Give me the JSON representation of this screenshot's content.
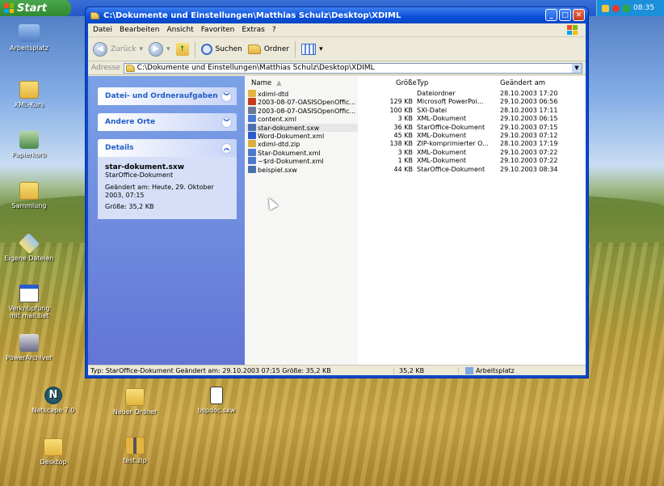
{
  "taskbar": {
    "start_label": "Start",
    "clock": "08:35"
  },
  "desktop_icons": [
    {
      "label": "Arbeitsplatz"
    },
    {
      "label": "XML-Kurs"
    },
    {
      "label": "Papierkorb"
    },
    {
      "label": "Sammlung"
    },
    {
      "label": "Eigene Dateien"
    },
    {
      "label": "Verknüpfung mit mail.bat"
    },
    {
      "label": "PowerArchiver"
    },
    {
      "label": "Netscape 7.0"
    },
    {
      "label": "Neuer Ordner"
    },
    {
      "label": "bspdoc.sxw"
    },
    {
      "label": "Desktop"
    },
    {
      "label": "test.zip"
    }
  ],
  "window": {
    "title": "C:\\Dokumente und Einstellungen\\Matthias Schulz\\Desktop\\XDIML",
    "menu": [
      "Datei",
      "Bearbeiten",
      "Ansicht",
      "Favoriten",
      "Extras",
      "?"
    ],
    "toolbar": {
      "back": "Zurück",
      "search": "Suchen",
      "folders": "Ordner"
    },
    "address": {
      "label": "Adresse",
      "value": "C:\\Dokumente und Einstellungen\\Matthias Schulz\\Desktop\\XDIML"
    },
    "taskpane": {
      "tasks_title": "Datei- und Ordneraufgaben",
      "other_title": "Andere Orte",
      "details_title": "Details",
      "details_name": "star-dokument.sxw",
      "details_type": "StarOffice-Dokument",
      "details_changed": "Geändert am: Heute, 29. Oktober 2003, 07:15",
      "details_size": "Größe: 35,2 KB"
    },
    "columns": {
      "name": "Name",
      "size": "Größe",
      "type": "Typ",
      "changed": "Geändert am"
    },
    "files": [
      {
        "name": "xdiml-dtd",
        "size": "",
        "type": "Dateiordner",
        "changed": "28.10.2003 17:20",
        "icon": "folder-icon"
      },
      {
        "name": "2003-08-07-OASISOpenOffic...",
        "size": "129 KB",
        "type": "Microsoft PowerPoi...",
        "changed": "29.10.2003 06:56",
        "icon": "powerpoint-file-icon"
      },
      {
        "name": "2003-08-07-OASISOpenOffic...",
        "size": "100 KB",
        "type": "SXI-Datei",
        "changed": "28.10.2003 17:11",
        "icon": "sxi-file-icon"
      },
      {
        "name": "content.xml",
        "size": "3 KB",
        "type": "XML-Dokument",
        "changed": "29.10.2003 06:15",
        "icon": "xml-file-icon"
      },
      {
        "name": "star-dokument.sxw",
        "size": "36 KB",
        "type": "StarOffice-Dokument",
        "changed": "29.10.2003 07:15",
        "icon": "staroffice-file-icon"
      },
      {
        "name": "Word-Dokument.xml",
        "size": "45 KB",
        "type": "XML-Dokument",
        "changed": "29.10.2003 07:12",
        "icon": "word-xml-file-icon"
      },
      {
        "name": "xdiml-dtd.zip",
        "size": "138 KB",
        "type": "ZIP-komprimierter O...",
        "changed": "28.10.2003 17:19",
        "icon": "zip-file-icon"
      },
      {
        "name": "Star-Dokument.xml",
        "size": "3 KB",
        "type": "XML-Dokument",
        "changed": "29.10.2003 07:22",
        "icon": "xml-file-icon"
      },
      {
        "name": "~$rd-Dokument.xml",
        "size": "1 KB",
        "type": "XML-Dokument",
        "changed": "29.10.2003 07:22",
        "icon": "xml-file-icon"
      },
      {
        "name": "beispiel.sxw",
        "size": "44 KB",
        "type": "StarOffice-Dokument",
        "changed": "29.10.2003 08:34",
        "icon": "staroffice-file-icon"
      }
    ],
    "status": {
      "info": "Typ: StarOffice-Dokument Geändert am: 29.10.2003 07:15 Größe: 35,2 KB",
      "size": "35,2 KB",
      "location": "Arbeitsplatz"
    }
  }
}
